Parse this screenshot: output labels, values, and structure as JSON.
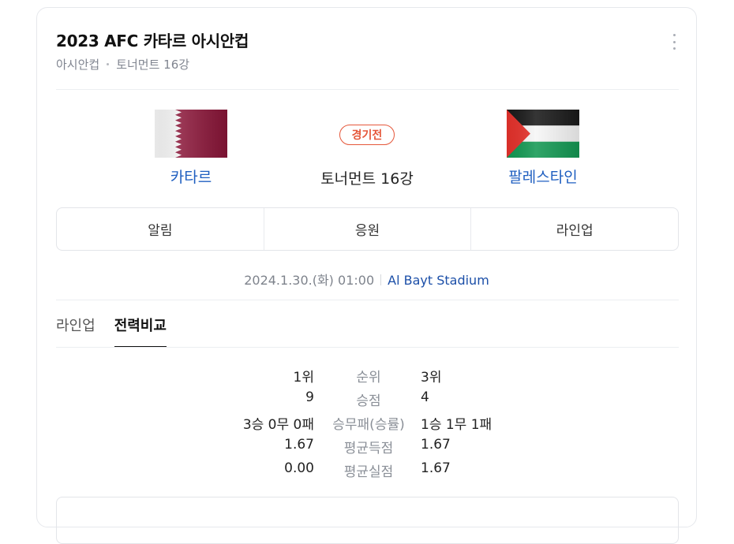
{
  "header": {
    "title": "2023 AFC 카타르 아시안컵",
    "league": "아시안컵",
    "round": "토너먼트 16강"
  },
  "match": {
    "status": "경기전",
    "round_label": "토너먼트 16강",
    "home_team": "카타르",
    "away_team": "팔레스타인",
    "datetime": "2024.1.30.(화) 01:00",
    "stadium": "Al Bayt Stadium"
  },
  "actions": [
    "알림",
    "응원",
    "라인업"
  ],
  "tabs": [
    {
      "label": "라인업",
      "active": false
    },
    {
      "label": "전력비교",
      "active": true
    }
  ],
  "comparison": [
    {
      "home": "1위",
      "label": "순위",
      "away": "3위"
    },
    {
      "home": "9",
      "label": "승점",
      "away": "4"
    },
    {
      "home": "3승 0무 0패",
      "label": "승무패(승률)",
      "away": "1승 1무 1패"
    },
    {
      "home": "1.67",
      "label": "평균득점",
      "away": "1.67"
    },
    {
      "home": "0.00",
      "label": "평균실점",
      "away": "1.67"
    }
  ],
  "icons": {
    "home_flag": "qatar-flag-icon",
    "away_flag": "palestine-flag-icon",
    "more": "more-vertical-icon"
  },
  "colors": {
    "team_link": "#1f5fc0",
    "status": "#e5573a",
    "stadium_link": "#1c4fa8",
    "qatar_maroon": "#8a1538",
    "palestine_red": "#e4312b",
    "palestine_green": "#149954"
  }
}
